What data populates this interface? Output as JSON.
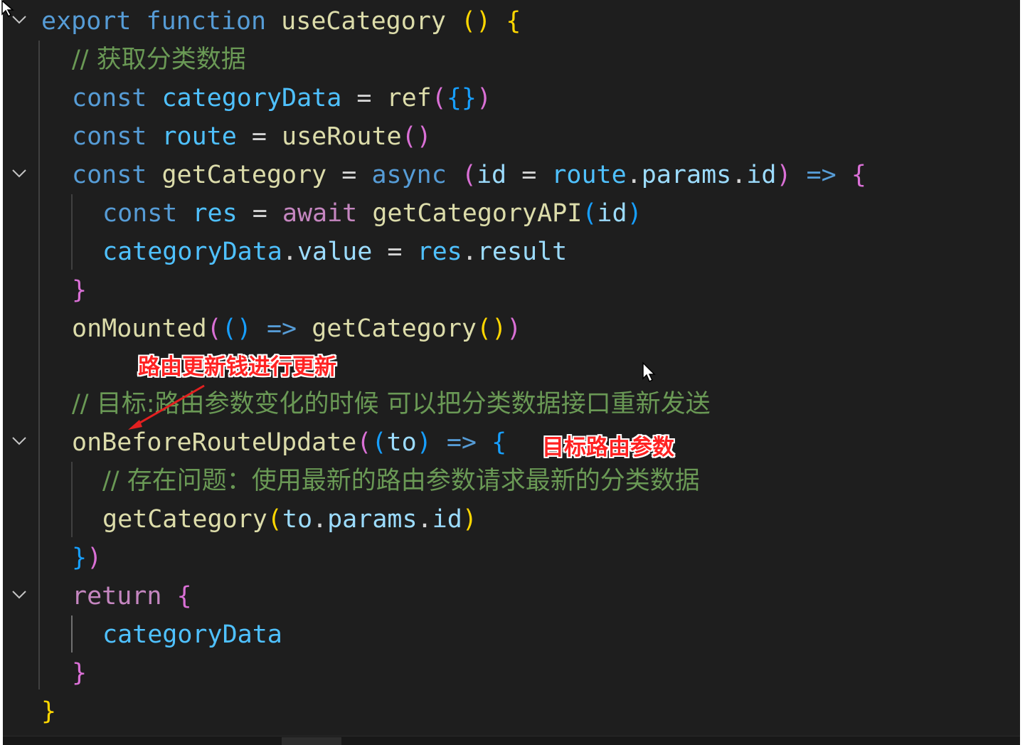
{
  "editor": {
    "lines": [
      {
        "tokens": [
          [
            "kw",
            "export"
          ],
          [
            "op",
            " "
          ],
          [
            "kw",
            "function"
          ],
          [
            "op",
            " "
          ],
          [
            "fn",
            "useCategory"
          ],
          [
            "op",
            " "
          ],
          [
            "b1",
            "()"
          ],
          [
            "op",
            " "
          ],
          [
            "b1",
            "{"
          ]
        ]
      },
      {
        "tokens": [
          [
            "cm",
            "// 获取分类数据"
          ]
        ]
      },
      {
        "tokens": [
          [
            "kw",
            "const"
          ],
          [
            "op",
            " "
          ],
          [
            "var",
            "categoryData"
          ],
          [
            "op",
            " = "
          ],
          [
            "fn",
            "ref"
          ],
          [
            "b2",
            "("
          ],
          [
            "b3",
            "{}"
          ],
          [
            "b2",
            ")"
          ]
        ]
      },
      {
        "tokens": [
          [
            "kw",
            "const"
          ],
          [
            "op",
            " "
          ],
          [
            "var",
            "route"
          ],
          [
            "op",
            " = "
          ],
          [
            "fn",
            "useRoute"
          ],
          [
            "b2",
            "()"
          ]
        ]
      },
      {
        "tokens": [
          [
            "kw",
            "const"
          ],
          [
            "op",
            " "
          ],
          [
            "fn",
            "getCategory"
          ],
          [
            "op",
            " = "
          ],
          [
            "kw",
            "async"
          ],
          [
            "op",
            " "
          ],
          [
            "b2",
            "("
          ],
          [
            "prop",
            "id"
          ],
          [
            "op",
            " = "
          ],
          [
            "var",
            "route"
          ],
          [
            "op",
            "."
          ],
          [
            "prop",
            "params"
          ],
          [
            "op",
            "."
          ],
          [
            "prop",
            "id"
          ],
          [
            "b2",
            ")"
          ],
          [
            "op",
            " "
          ],
          [
            "kw",
            "=>"
          ],
          [
            "op",
            " "
          ],
          [
            "b2",
            "{"
          ]
        ]
      },
      {
        "tokens": [
          [
            "kw",
            "const"
          ],
          [
            "op",
            " "
          ],
          [
            "var",
            "res"
          ],
          [
            "op",
            " = "
          ],
          [
            "kwc",
            "await"
          ],
          [
            "op",
            " "
          ],
          [
            "fn",
            "getCategoryAPI"
          ],
          [
            "b3",
            "("
          ],
          [
            "prop",
            "id"
          ],
          [
            "b3",
            ")"
          ]
        ]
      },
      {
        "tokens": [
          [
            "var",
            "categoryData"
          ],
          [
            "op",
            "."
          ],
          [
            "prop",
            "value"
          ],
          [
            "op",
            " = "
          ],
          [
            "var",
            "res"
          ],
          [
            "op",
            "."
          ],
          [
            "prop",
            "result"
          ]
        ]
      },
      {
        "tokens": [
          [
            "b2",
            "}"
          ]
        ]
      },
      {
        "tokens": [
          [
            "fn",
            "onMounted"
          ],
          [
            "b2",
            "("
          ],
          [
            "b3",
            "()"
          ],
          [
            "op",
            " "
          ],
          [
            "kw",
            "=>"
          ],
          [
            "op",
            " "
          ],
          [
            "fn",
            "getCategory"
          ],
          [
            "b1",
            "()"
          ],
          [
            "b2",
            ")"
          ]
        ]
      },
      {
        "tokens": []
      },
      {
        "tokens": [
          [
            "cm",
            "// 目标:路由参数变化的时候 可以把分类数据接口重新发送"
          ]
        ]
      },
      {
        "tokens": [
          [
            "fn",
            "onBeforeRouteUpdate"
          ],
          [
            "b2",
            "("
          ],
          [
            "b3",
            "("
          ],
          [
            "prop",
            "to"
          ],
          [
            "b3",
            ")"
          ],
          [
            "op",
            " "
          ],
          [
            "kw",
            "=>"
          ],
          [
            "op",
            " "
          ],
          [
            "b3",
            "{"
          ]
        ]
      },
      {
        "tokens": [
          [
            "cm",
            "// 存在问题：使用最新的路由参数请求最新的分类数据"
          ]
        ]
      },
      {
        "tokens": [
          [
            "fn",
            "getCategory"
          ],
          [
            "b1",
            "("
          ],
          [
            "prop",
            "to"
          ],
          [
            "op",
            "."
          ],
          [
            "prop",
            "params"
          ],
          [
            "op",
            "."
          ],
          [
            "prop",
            "id"
          ],
          [
            "b1",
            ")"
          ]
        ]
      },
      {
        "tokens": [
          [
            "b3",
            "}"
          ],
          [
            "b2",
            ")"
          ]
        ]
      },
      {
        "tokens": [
          [
            "kwc",
            "return"
          ],
          [
            "op",
            " "
          ],
          [
            "b2",
            "{"
          ]
        ]
      },
      {
        "tokens": [
          [
            "var",
            "categoryData"
          ]
        ]
      },
      {
        "tokens": [
          [
            "b2",
            "}"
          ]
        ]
      },
      {
        "tokens": [
          [
            "b1",
            "}"
          ]
        ]
      }
    ]
  },
  "annotations": {
    "note_route_update": "路由更新钱进行更新",
    "note_target_params": "目标路由参数"
  },
  "icons": {
    "fold": "chevron-down-icon",
    "pointer": "mouse-pointer-icon",
    "arrow": "red-arrow"
  },
  "colors": {
    "background": "#1e1e1e",
    "keyword": "#569cd6",
    "control_keyword": "#c586c0",
    "function": "#dcdcaa",
    "variable": "#4fc1ff",
    "property": "#9cdcfe",
    "comment": "#6a9955",
    "annotation": "#ff2222"
  }
}
